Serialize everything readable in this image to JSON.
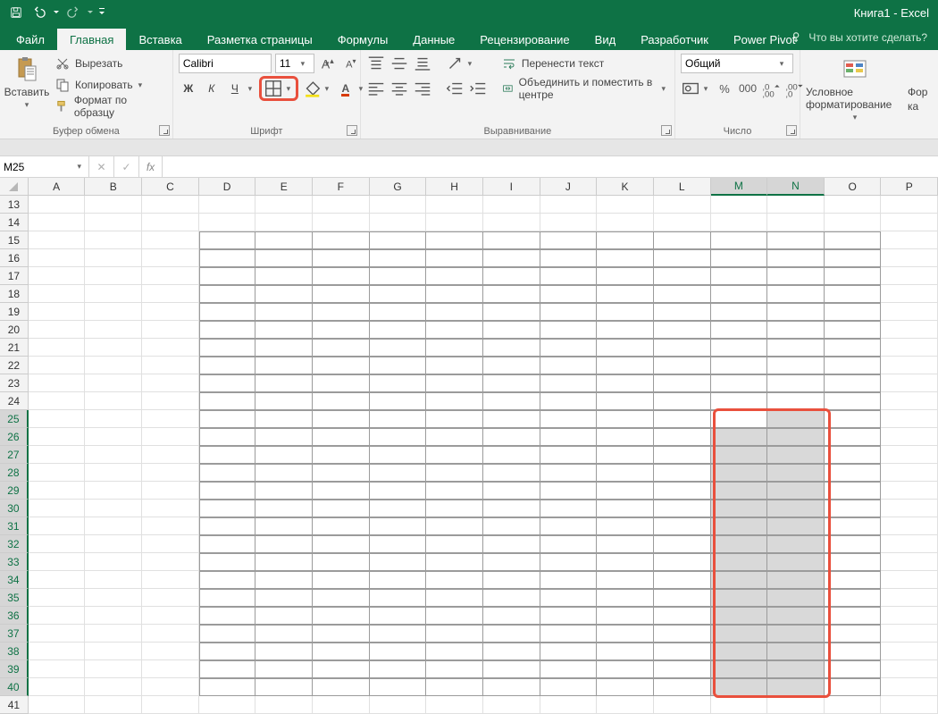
{
  "title": "Книга1 - Excel",
  "qat": {
    "save": "save",
    "undo": "undo",
    "redo": "redo"
  },
  "tabs": [
    "Файл",
    "Главная",
    "Вставка",
    "Разметка страницы",
    "Формулы",
    "Данные",
    "Рецензирование",
    "Вид",
    "Разработчик",
    "Power Pivot"
  ],
  "active_tab": 1,
  "tell_me": "Что вы хотите сделать?",
  "ribbon": {
    "clipboard": {
      "paste": "Вставить",
      "cut": "Вырезать",
      "copy": "Копировать",
      "format_painter": "Формат по образцу",
      "label": "Буфер обмена"
    },
    "font": {
      "name": "Calibri",
      "size": "11",
      "bold": "Ж",
      "italic": "К",
      "underline": "Ч",
      "label": "Шрифт"
    },
    "alignment": {
      "wrap": "Перенести текст",
      "merge": "Объединить и поместить в центре",
      "label": "Выравнивание"
    },
    "number": {
      "format": "Общий",
      "label": "Число"
    },
    "styles": {
      "cond": "Условное форматирование",
      "fmt": "Фор",
      "ka": "ка"
    }
  },
  "formula_bar": {
    "name_box": "M25",
    "fx": "fx"
  },
  "grid": {
    "columns": [
      "A",
      "B",
      "C",
      "D",
      "E",
      "F",
      "G",
      "H",
      "I",
      "J",
      "K",
      "L",
      "M",
      "N",
      "O",
      "P"
    ],
    "selected_cols": [
      "M",
      "N"
    ],
    "first_row": 13,
    "last_row": 41,
    "selected_rows_from": 25,
    "selected_rows_to": 40,
    "bordered_cols_from": "D",
    "bordered_cols_to": "O",
    "bordered_rows_from": 15,
    "bordered_rows_to": 40,
    "active_cell": "M25"
  }
}
